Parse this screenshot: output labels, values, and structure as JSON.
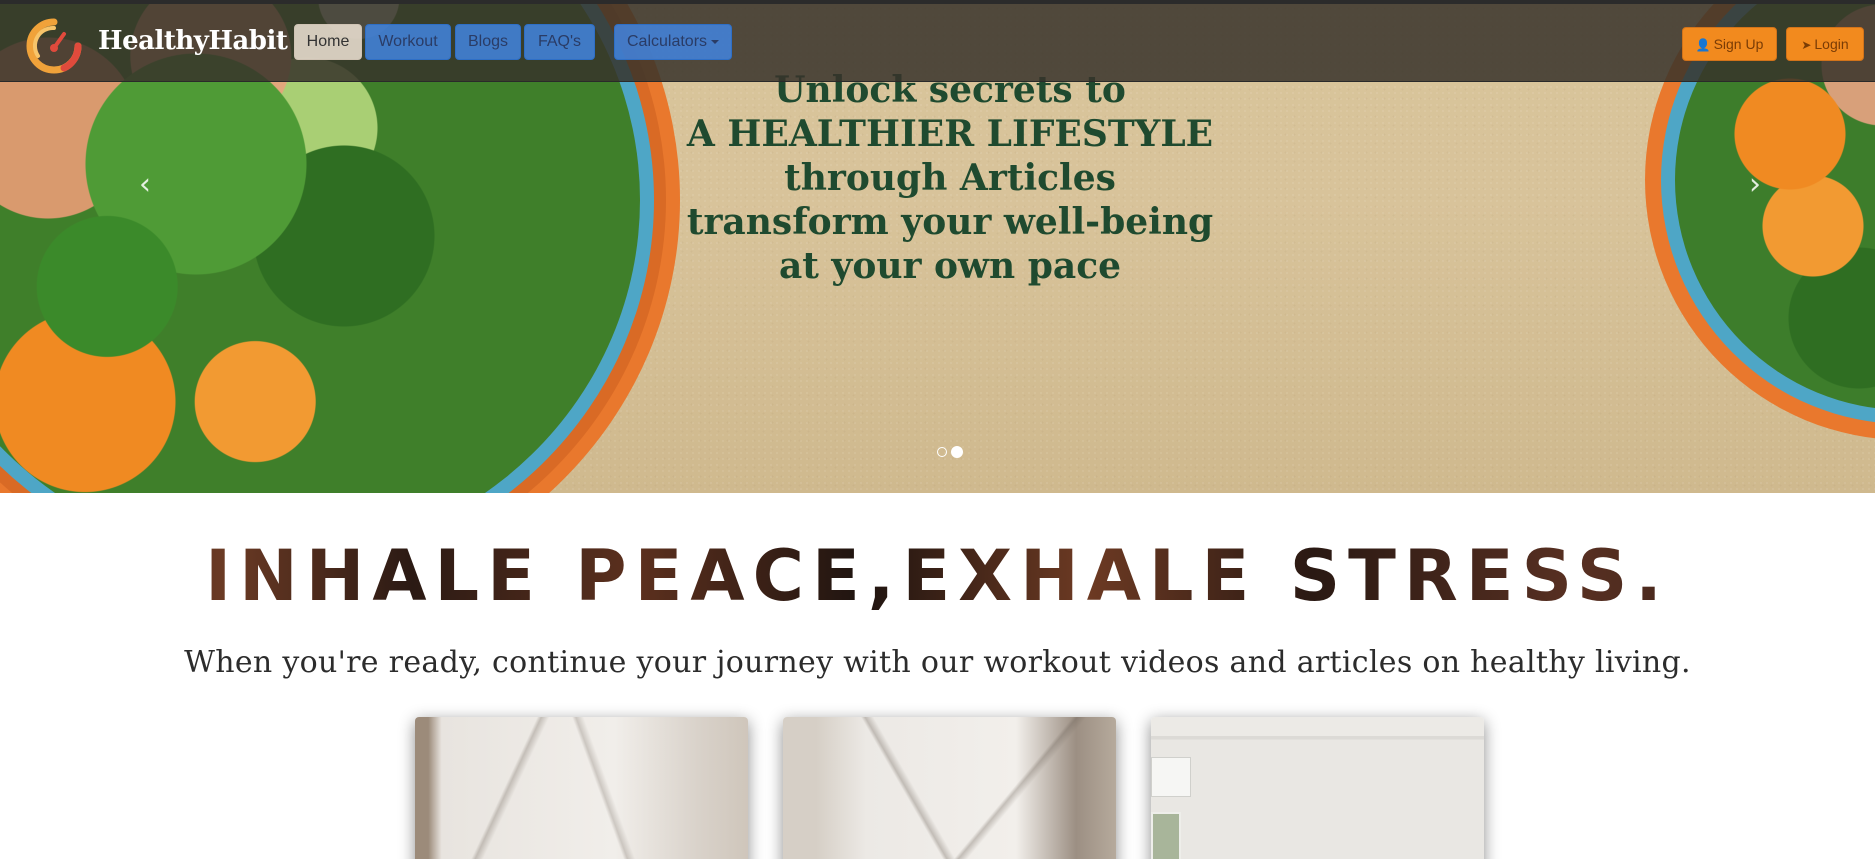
{
  "nav": {
    "brand": "HealthyHabit",
    "home": "Home",
    "workout": "Workout",
    "blogs": "Blogs",
    "faqs": "FAQ's",
    "calculators": "Calculators",
    "signup": "Sign Up",
    "login": "Login",
    "icons": {
      "signup": "user-icon",
      "login": "login-icon",
      "calculators": "caret-down-icon",
      "logo": "gauge-logo-icon"
    }
  },
  "hero": {
    "lines": [
      "Unlock secrets to",
      "A HEALTHIER LIFESTYLE",
      "through Articles",
      "transform your well-being",
      "at your own pace"
    ],
    "slide_count": 2,
    "active_slide": 2,
    "prev_icon": "chevron-left-icon",
    "next_icon": "chevron-right-icon",
    "text_color": "#1f4a2f"
  },
  "main": {
    "headline": "INHALE PEACE,EXHALE STRESS.",
    "subtitle": "When you're ready, continue your journey with our workout videos and articles on healthy living."
  },
  "colors": {
    "navbar": "#37322a",
    "nav_blue": "#4285e0",
    "nav_orange": "#f28a1e",
    "hero_bg": "#d9c49a"
  }
}
